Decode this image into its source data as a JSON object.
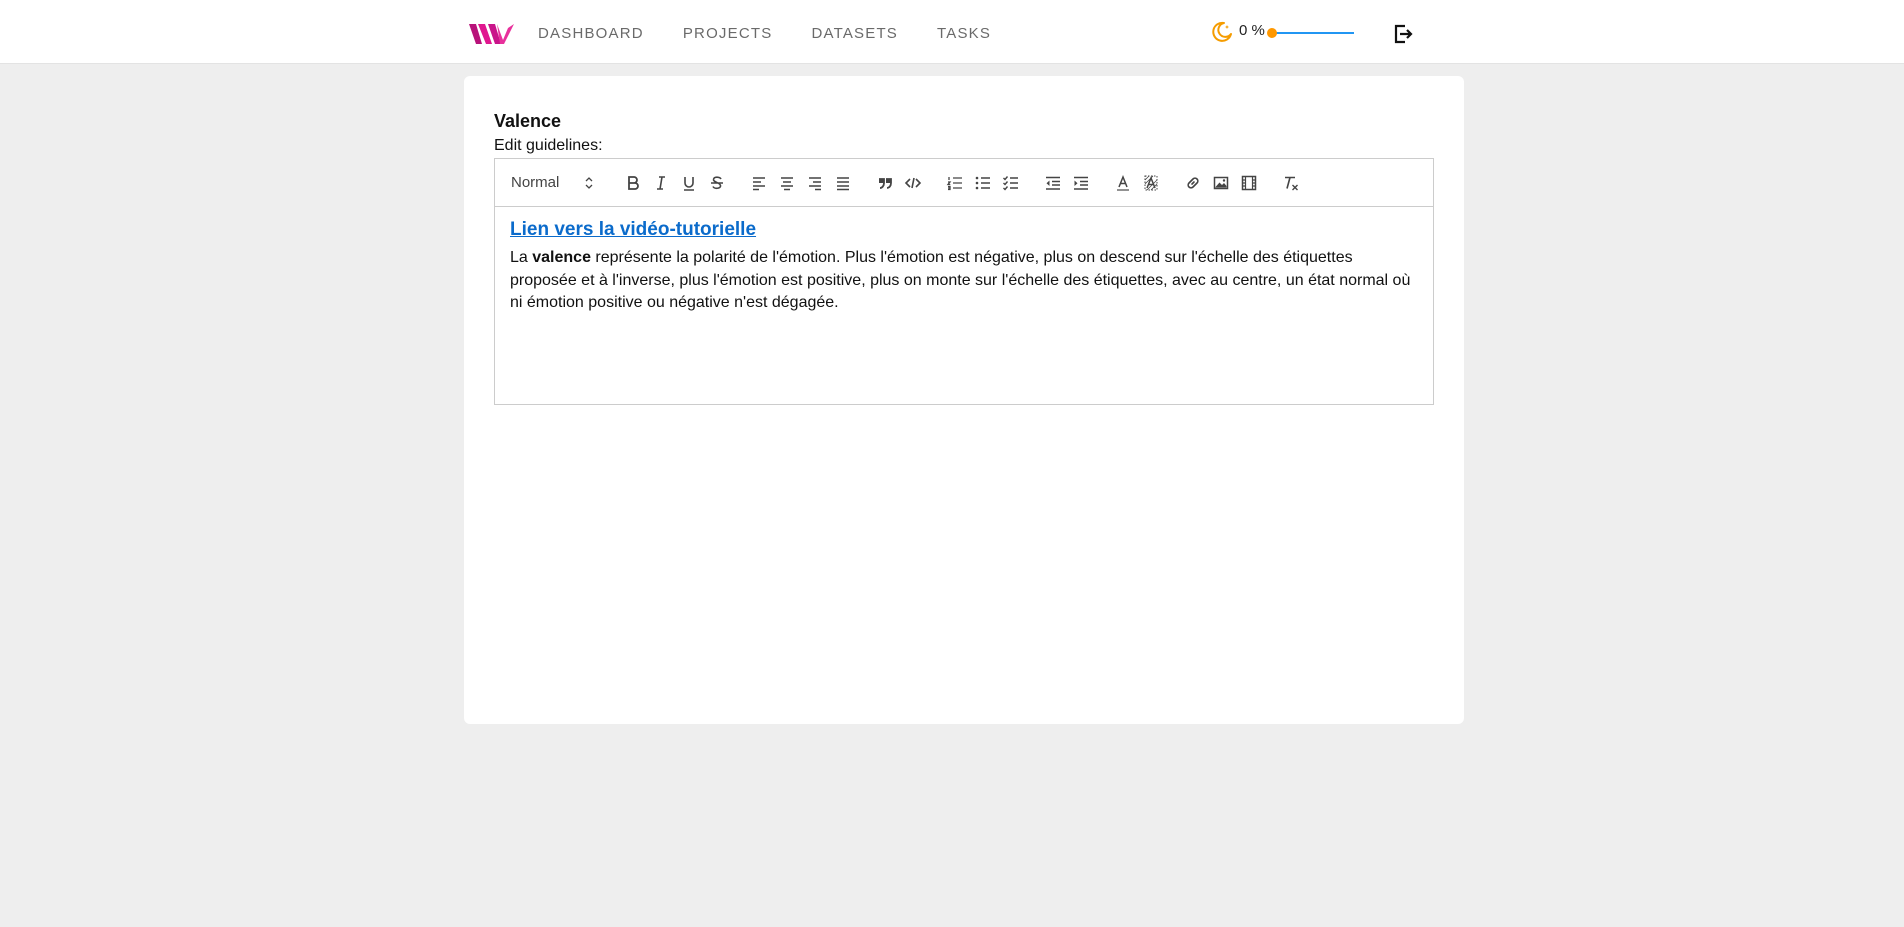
{
  "nav": {
    "items": [
      {
        "label": "DASHBOARD"
      },
      {
        "label": "PROJECTS"
      },
      {
        "label": "DATASETS"
      },
      {
        "label": "TASKS"
      }
    ]
  },
  "header": {
    "zoom_value": "0 %",
    "zoom_level": 0,
    "icons": [
      "logo",
      "theme-moon-icon",
      "logout-icon"
    ]
  },
  "card": {
    "title": "Valence",
    "subtitle": "Edit guidelines:"
  },
  "editor": {
    "format_select": "Normal",
    "toolbar_icons": [
      "bold-icon",
      "italic-icon",
      "underline-icon",
      "strike-icon",
      "align-left-icon",
      "align-center-icon",
      "align-right-icon",
      "align-justify-icon",
      "blockquote-icon",
      "code-block-icon",
      "ordered-list-icon",
      "bullet-list-icon",
      "check-list-icon",
      "outdent-icon",
      "indent-icon",
      "text-color-icon",
      "background-color-icon",
      "link-icon",
      "image-icon",
      "video-icon",
      "clear-format-icon"
    ],
    "content": {
      "link_text": "Lien vers la vidéo-tutorielle",
      "para_prefix": "La ",
      "para_bold": "valence",
      "para_rest": " représente la polarité de l'émotion. Plus l'émotion est négative, plus on descend sur l'échelle des étiquettes proposée et à l'inverse, plus l'émotion est positive, plus on monte sur l'échelle des étiquettes, avec au centre, un état normal où ni émotion positive ou négative n'est dégagée."
    }
  },
  "colors": {
    "background": "#eeeeee",
    "card": "#ffffff",
    "logo_magenta": "#e0178f",
    "link": "#0b6bcb",
    "slider_track": "#2196f3",
    "slider_thumb": "#ff9800",
    "theme_icon": "#f59c00"
  }
}
